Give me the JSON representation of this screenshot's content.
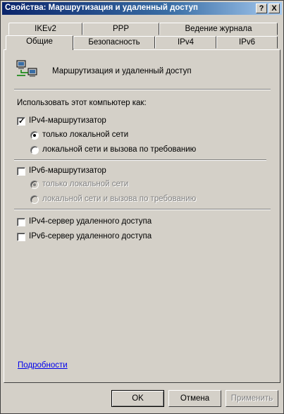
{
  "window": {
    "title": "Свойства: Маршрутизация и удаленный доступ",
    "help_btn": "?",
    "close_btn": "X"
  },
  "tabs": {
    "top": [
      "IKEv2",
      "PPP",
      "Ведение журнала"
    ],
    "bottom": [
      "Общие",
      "Безопасность",
      "IPv4",
      "IPv6"
    ]
  },
  "header": {
    "title": "Маршрутизация и удаленный доступ",
    "icon": "network-computers-icon"
  },
  "section": {
    "label": "Использовать этот компьютер как:"
  },
  "ipv4_router": {
    "label": "IPv4-маршрутизатор",
    "checked": true,
    "options": [
      "только локальной сети",
      "локальной сети и вызова по требованию"
    ],
    "selected": 0
  },
  "ipv6_router": {
    "label": "IPv6-маршрутизатор",
    "checked": false,
    "options": [
      "только локальной сети",
      "локальной сети и вызова по требованию"
    ],
    "selected": 0
  },
  "ipv4_server": {
    "label": "IPv4-сервер удаленного доступа",
    "checked": false
  },
  "ipv6_server": {
    "label": "IPv6-сервер удаленного доступа",
    "checked": false
  },
  "details_link": "Подробности",
  "buttons": {
    "ok": "OK",
    "cancel": "Отмена",
    "apply": "Применить"
  }
}
